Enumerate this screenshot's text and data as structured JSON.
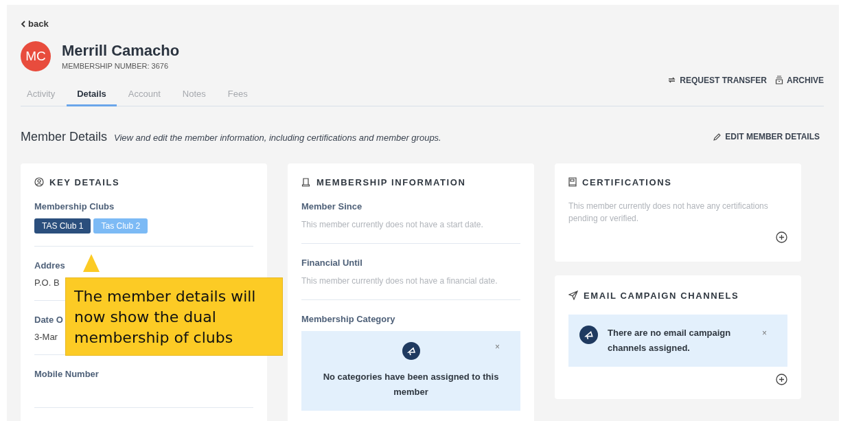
{
  "back": {
    "label": "back"
  },
  "member": {
    "initials": "MC",
    "name": "Merrill Camacho",
    "membership_number": "MEMBERSHIP NUMBER: 3676"
  },
  "tabs": [
    {
      "label": "Activity",
      "selected": false
    },
    {
      "label": "Details",
      "selected": true
    },
    {
      "label": "Account",
      "selected": false
    },
    {
      "label": "Notes",
      "selected": false
    },
    {
      "label": "Fees",
      "selected": false
    }
  ],
  "actions": [
    {
      "kind": "transfer",
      "label": "REQUEST TRANSFER"
    },
    {
      "kind": "archive",
      "label": "ARCHIVE"
    }
  ],
  "section": {
    "title": "Member Details",
    "subtitle": "View and edit the member information, including certifications and member groups.",
    "edit": "EDIT MEMBER DETAILS"
  },
  "key_details": {
    "title": "KEY DETAILS",
    "clubs_label": "Membership Clubs",
    "clubs": [
      {
        "label": "TAS Club 1",
        "selected": true
      },
      {
        "label": "Tas Club 2",
        "selected": false
      }
    ],
    "fields": [
      {
        "label": "Addres",
        "value": "P.O. B"
      },
      {
        "label": "Date O",
        "value": "3-Mar"
      },
      {
        "label": "Mobile Number"
      }
    ]
  },
  "membership_information": {
    "title": "MEMBERSHIP INFORMATION",
    "fields": [
      {
        "label": "Member Since",
        "value": "This member currently does not have a start date."
      },
      {
        "label": "Financial Until",
        "value": "This member currently does not have a financial date."
      }
    ],
    "category_label": "Membership Category",
    "category_notice": "No categories have been assigned to this member",
    "close": "×"
  },
  "certifications": {
    "title": "CERTIFICATIONS",
    "empty": "This member currently does not have any certifications pending or verified."
  },
  "email_campaign_channels": {
    "title": "EMAIL CAMPAIGN CHANNELS",
    "notice": "There are no email campaign channels assigned.",
    "close": "×"
  },
  "callout": {
    "text": "The member details will now show the dual membership of clubs"
  }
}
